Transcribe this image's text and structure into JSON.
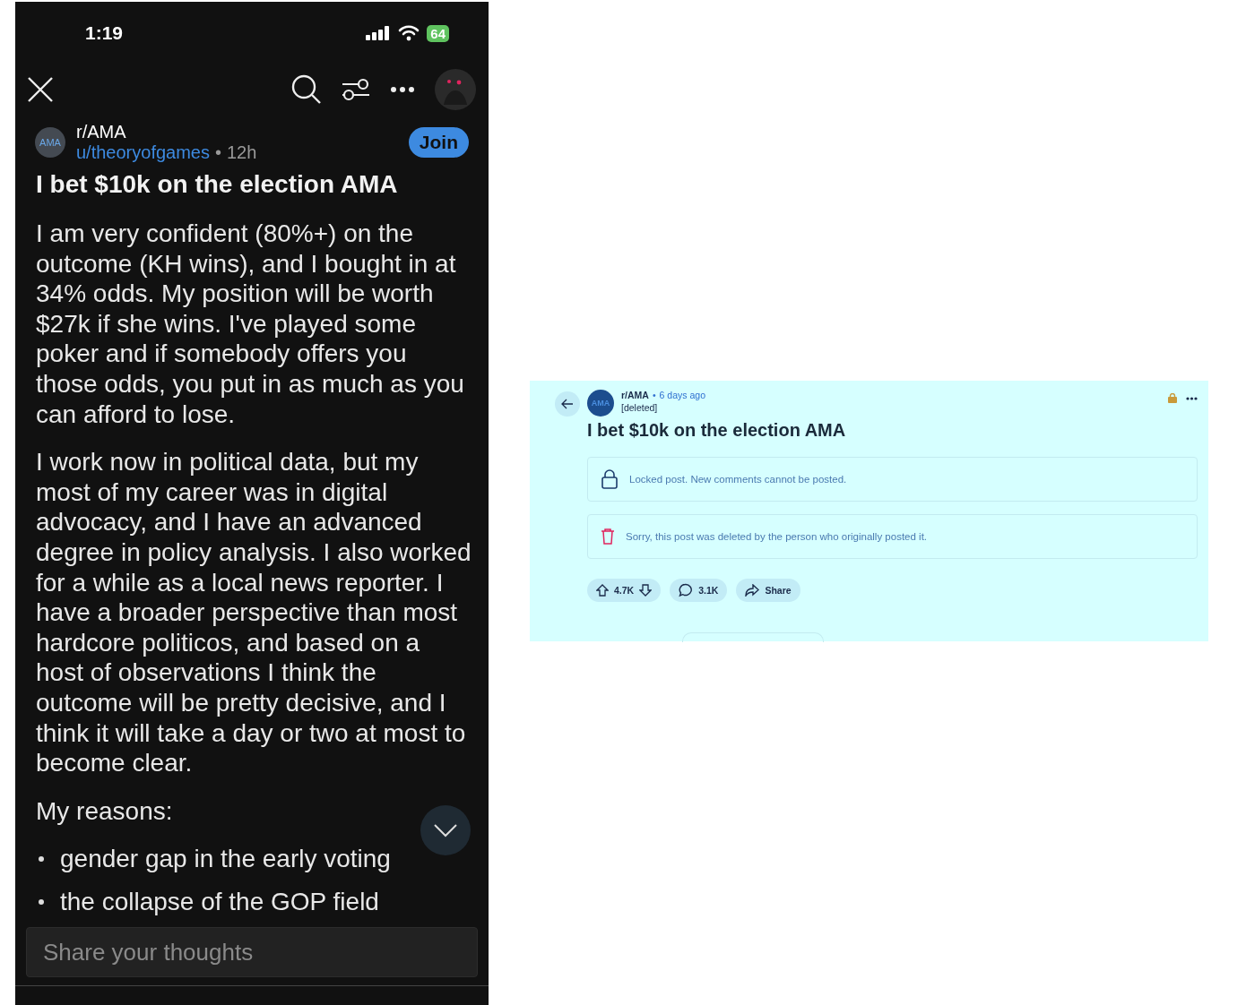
{
  "phone": {
    "status_bar": {
      "time": "1:19",
      "battery": "64"
    },
    "post": {
      "subreddit": "r/AMA",
      "avatar": "AMA",
      "author": "u/theoryofgames",
      "separator": "•",
      "age": "12h",
      "join": "Join",
      "title": "I bet $10k on the election AMA",
      "paragraphs": [
        "I am very confident (80%+) on the outcome (KH wins), and I bought in at 34% odds. My position will be worth $27k if she wins. I've played some poker and if somebody offers you those odds, you put in as much as you can afford to lose.",
        "I work now in political data, but my most of my career was in digital advocacy, and I have an advanced degree in policy analysis. I also worked for a while as a local news reporter. I have a broader perspective than most hardcore politicos, and based on a host of observations I think the outcome will be pretty decisive, and I think it will take a day or two at most to become clear.",
        "My reasons:"
      ],
      "bullets": [
        "gender gap in the early voting",
        "the collapse of the GOP field"
      ]
    },
    "comment": {
      "placeholder": "Share your thoughts"
    }
  },
  "web": {
    "subreddit": "r/AMA",
    "avatar": "AMA",
    "separator": "•",
    "age": "6 days ago",
    "author": "[deleted]",
    "title": "I bet $10k on the election AMA",
    "notices": [
      {
        "kind": "locked",
        "text": "Locked post. New comments cannot be posted."
      },
      {
        "kind": "deleted",
        "text": "Sorry, this post was deleted by the person who originally posted it."
      }
    ],
    "votes": "4.7K",
    "comments": "3.1K",
    "share": "Share"
  }
}
